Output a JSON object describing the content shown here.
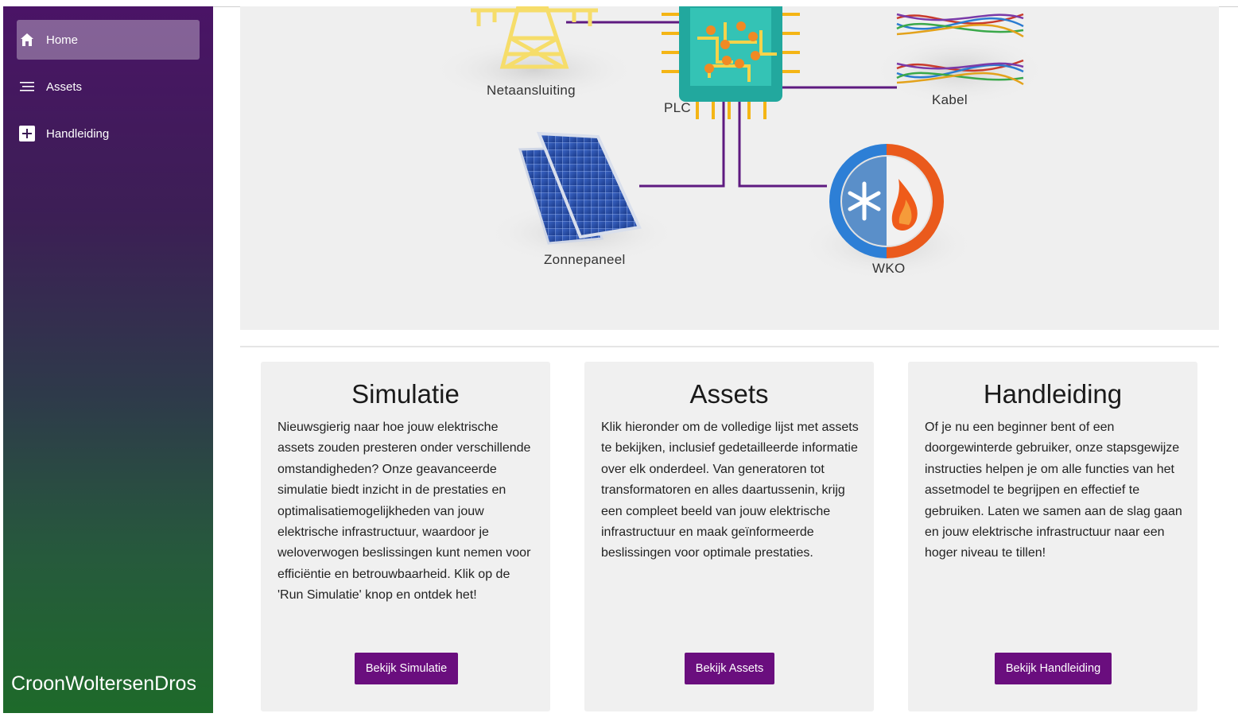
{
  "sidebar": {
    "items": [
      {
        "label": "Home",
        "icon": "home-icon",
        "active": true
      },
      {
        "label": "Assets",
        "icon": "list-icon",
        "active": false
      },
      {
        "label": "Handleiding",
        "icon": "plus-icon",
        "active": false
      }
    ],
    "brand": "CroonWoltersenDros"
  },
  "hero": {
    "labels": {
      "netaansluiting": "Netaansluiting",
      "plc": "PLC",
      "kabel": "Kabel",
      "zonnepaneel": "Zonnepaneel",
      "wko": "WKO"
    }
  },
  "cards": [
    {
      "title": "Simulatie",
      "text": "Nieuwsgierig naar hoe jouw elektrische assets zouden presteren onder verschillende omstandigheden? Onze geavanceerde simulatie biedt inzicht in de prestaties en optimalisatiemogelijkheden van jouw elektrische infrastructuur, waardoor je weloverwogen beslissingen kunt nemen voor efficiëntie en betrouwbaarheid. Klik op de 'Run Simulatie' knop en ontdek het!",
      "button": "Bekijk Simulatie"
    },
    {
      "title": "Assets",
      "text": "Klik hieronder om de volledige lijst met assets te bekijken, inclusief gedetailleerde informatie over elk onderdeel. Van generatoren tot transformatoren en alles daartussenin, krijg een compleet beeld van jouw elektrische infrastructuur en maak geïnformeerde beslissingen voor optimale prestaties.",
      "button": "Bekijk Assets"
    },
    {
      "title": "Handleiding",
      "text": "Of je nu een beginner bent of een doorgewinterde gebruiker, onze stapsgewijze instructies helpen je om alle functies van het assetmodel te begrijpen en effectief te gebruiken. Laten we samen aan de slag gaan en jouw elektrische infrastructuur naar een hoger niveau te tillen!",
      "button": "Bekijk Handleiding"
    }
  ],
  "colors": {
    "accent": "#6a0e7e",
    "line": "#5e1a80"
  }
}
